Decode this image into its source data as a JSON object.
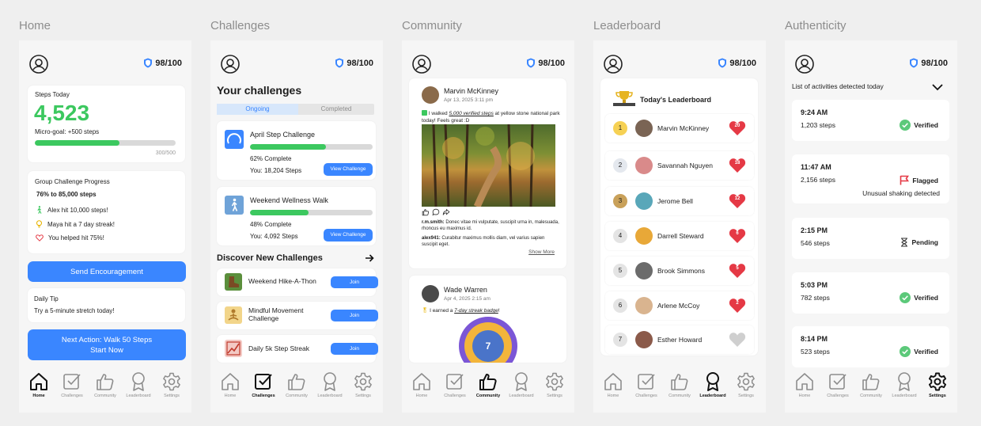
{
  "screens": {
    "home": "Home",
    "challenges": "Challenges",
    "community": "Community",
    "leaderboard": "Leaderboard",
    "authenticity": "Authenticity"
  },
  "header": {
    "score": "98/100"
  },
  "nav": {
    "home": "Home",
    "challenges": "Challenges",
    "community": "Community",
    "leaderboard": "Leaderboard",
    "settings": "Settings"
  },
  "home": {
    "steps_title": "Steps Today",
    "steps_value": "4,523",
    "micro_goal": "Micro-goal: +500 steps",
    "goal_progress": 0.6,
    "goal_label": "300/500",
    "group_title": "Group Challenge Progress",
    "group_progress": "76% to 85,000 steps",
    "feed": [
      "Alex hit 10,000 steps!",
      "Maya hit a 7 day streak!",
      "You helped hit 75%!"
    ],
    "encourage_button": "Send Encouragement",
    "tip_title": "Daily Tip",
    "tip_text": "Try a 5-minute stretch today!",
    "next_action_line1": "Next Action: Walk 50 Steps",
    "next_action_line2": "Start Now"
  },
  "challenges": {
    "title": "Your challenges",
    "tab_ongoing": "Ongoing",
    "tab_completed": "Completed",
    "items": [
      {
        "name": "April Step Challenge",
        "progress": 0.62,
        "complete": "62% Complete",
        "you": "You: 18,204 Steps",
        "button": "View Challenge"
      },
      {
        "name": "Weekend Wellness Walk",
        "progress": 0.48,
        "complete": "48% Complete",
        "you": "You: 4,092 Steps",
        "button": "View Challenge"
      }
    ],
    "discover_title": "Discover New Challenges",
    "discover": [
      {
        "name": "Weekend Hike-A-Thon",
        "button": "Join"
      },
      {
        "name": "Mindful Movement Challenge",
        "button": "Join"
      },
      {
        "name": "Daily 5k Step Streak",
        "button": "Join"
      }
    ]
  },
  "community": {
    "post1": {
      "author": "Marvin McKinney",
      "date": "Apr 13, 2025 3:11 pm",
      "text_pre": "I walked ",
      "text_link": "5,000 verified steps",
      "text_post": " at yellow stone national park today! Feels great :D",
      "comment1_user": "r.m.smith:",
      "comment1_text": " Donec vitae mi vulputate, suscipit urna in, malesuada, rhoncus eu maximus id.",
      "comment2_user": "alex941:",
      "comment2_text": " Curabitur maximus mollis diam, vel varius sapien suscipit eget.",
      "show_more": "Show More"
    },
    "post2": {
      "author": "Wade Warren",
      "date": "Apr 4, 2025 2:15 am",
      "text_pre": "I earned a ",
      "text_link": "7-day streak badge",
      "text_post": "!",
      "badge_number": "7"
    }
  },
  "leaderboard": {
    "title": "Today's Leaderboard",
    "rows": [
      {
        "rank": "1",
        "name": "Marvin McKinney",
        "hearts": "20"
      },
      {
        "rank": "2",
        "name": "Savannah Nguyen",
        "hearts": "18"
      },
      {
        "rank": "3",
        "name": "Jerome Bell",
        "hearts": "12"
      },
      {
        "rank": "4",
        "name": "Darrell Steward",
        "hearts": "6"
      },
      {
        "rank": "5",
        "name": "Brook Simmons",
        "hearts": "5"
      },
      {
        "rank": "6",
        "name": "Arlene McCoy",
        "hearts": "2"
      },
      {
        "rank": "7",
        "name": "Esther Howard",
        "hearts": ""
      }
    ]
  },
  "authenticity": {
    "list_title": "List of activities detected today",
    "items": [
      {
        "time": "9:24 AM",
        "steps": "1,203 steps",
        "status": "Verified",
        "note": ""
      },
      {
        "time": "11:47 AM",
        "steps": "2,156 steps",
        "status": "Flagged",
        "note": "Unusual shaking detected"
      },
      {
        "time": "2:15 PM",
        "steps": "546 steps",
        "status": "Pending",
        "note": ""
      },
      {
        "time": "5:03 PM",
        "steps": "782 steps",
        "status": "Verified",
        "note": ""
      },
      {
        "time": "8:14 PM",
        "steps": "523 steps",
        "status": "Verified",
        "note": ""
      }
    ]
  },
  "colors": {
    "accent": "#3a86ff",
    "green": "#3cc85f",
    "red": "#e53945"
  }
}
